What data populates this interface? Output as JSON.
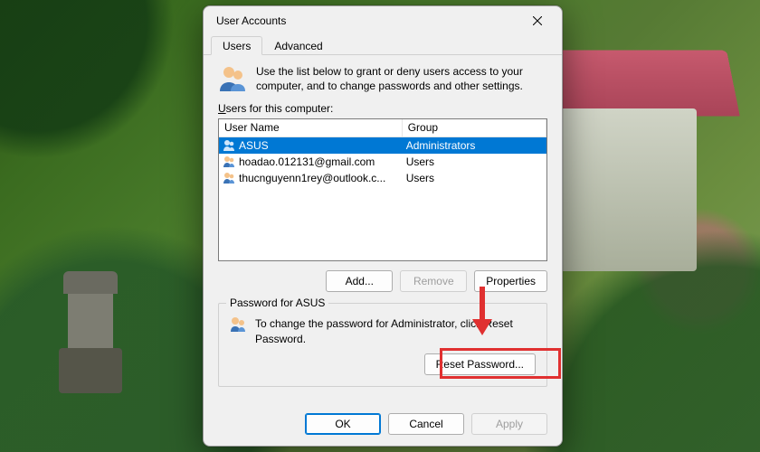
{
  "window": {
    "title": "User Accounts"
  },
  "tabs": {
    "users": "Users",
    "advanced": "Advanced"
  },
  "intro": "Use the list below to grant or deny users access to your computer, and to change passwords and other settings.",
  "list": {
    "label": "Users for this computer:",
    "col_user": "User Name",
    "col_group": "Group",
    "rows": [
      {
        "name": "ASUS",
        "group": "Administrators",
        "selected": true
      },
      {
        "name": "hoadao.012131@gmail.com",
        "group": "Users",
        "selected": false
      },
      {
        "name": "thucnguyenn1rey@outlook.c...",
        "group": "Users",
        "selected": false
      }
    ]
  },
  "buttons": {
    "add": "Add...",
    "remove": "Remove",
    "properties": "Properties",
    "reset": "Reset Password...",
    "ok": "OK",
    "cancel": "Cancel",
    "apply": "Apply"
  },
  "password": {
    "group_title": "Password for ASUS",
    "text": "To change the password for Administrator, click Reset Password."
  },
  "colors": {
    "selection": "#0078d4",
    "highlight": "#e03030"
  }
}
